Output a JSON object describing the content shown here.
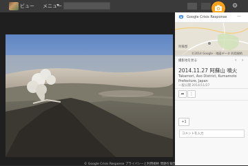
{
  "topbar": {
    "view_label": "ビュー",
    "menu_label": "メニュー",
    "search_placeholder": "",
    "camera_color": "#f7a21b",
    "icons": [
      "photo-thumbnail-icon",
      "chevron-down-icon",
      "camera-icon",
      "gear-icon"
    ]
  },
  "viewer": {
    "footer": "© Google Crisis Response プライバシーと利用規約 問題を報告"
  },
  "panel": {
    "header_title": "Google Crisis Response",
    "map_label": "阿蘇郡",
    "map_copyright": "©2014 Google - 地図データ 利用規約",
    "nav_label": "撮影地を見る",
    "title": "2014.11.27 阿蘇山 噴火",
    "location": "Takamori, Aso District, Kumamoto Prefecture, Japan",
    "meta": "一般公開 2014/11/27",
    "plusone_label": "+1",
    "comment_placeholder": "コメントを入力"
  }
}
